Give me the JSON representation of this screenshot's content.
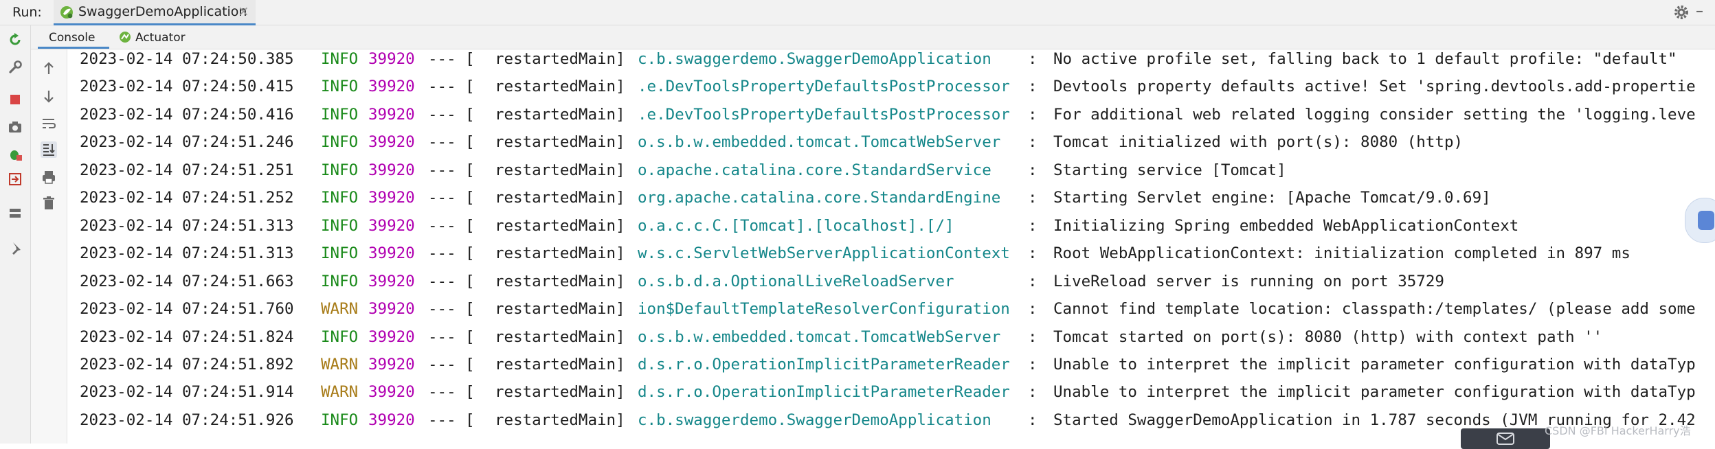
{
  "run_bar": {
    "label": "Run:",
    "tab_title": "SwaggerDemoApplication",
    "close_glyph": "×",
    "minimize_glyph": "–"
  },
  "sub_tabs": [
    {
      "label": "Console",
      "active": true
    },
    {
      "label": "Actuator",
      "active": false
    }
  ],
  "left_toolbar_icons": [
    "rerun-icon",
    "wrench-icon",
    "stop-icon",
    "camera-icon",
    "debug-icon",
    "exit-icon",
    "layout-icon",
    "pin-icon"
  ],
  "console_toolbar_icons": [
    "scroll-up-icon",
    "scroll-down-icon",
    "soft-wrap-icon",
    "scroll-to-end-icon",
    "print-icon",
    "clear-icon"
  ],
  "colors": {
    "info": "#1a8a1a",
    "warn": "#a77b17",
    "pid": "#b100b1",
    "logger": "#15878a",
    "accent": "#4a88c7"
  },
  "log_lines": [
    {
      "ts": "2023-02-14 07:24:50.385",
      "level": "INFO",
      "pid": "39920",
      "dash": "--- [",
      "thread": "restartedMain]",
      "logger": "c.b.swaggerdemo.SwaggerDemoApplication",
      "colon": ":",
      "msg": "No active profile set, falling back to 1 default profile: \"default\""
    },
    {
      "ts": "2023-02-14 07:24:50.415",
      "level": "INFO",
      "pid": "39920",
      "dash": "--- [",
      "thread": "restartedMain]",
      "logger": ".e.DevToolsPropertyDefaultsPostProcessor",
      "colon": ":",
      "msg": "Devtools property defaults active! Set 'spring.devtools.add-propertie"
    },
    {
      "ts": "2023-02-14 07:24:50.416",
      "level": "INFO",
      "pid": "39920",
      "dash": "--- [",
      "thread": "restartedMain]",
      "logger": ".e.DevToolsPropertyDefaultsPostProcessor",
      "colon": ":",
      "msg": "For additional web related logging consider setting the 'logging.leve"
    },
    {
      "ts": "2023-02-14 07:24:51.246",
      "level": "INFO",
      "pid": "39920",
      "dash": "--- [",
      "thread": "restartedMain]",
      "logger": "o.s.b.w.embedded.tomcat.TomcatWebServer",
      "colon": ":",
      "msg": "Tomcat initialized with port(s): 8080 (http)"
    },
    {
      "ts": "2023-02-14 07:24:51.251",
      "level": "INFO",
      "pid": "39920",
      "dash": "--- [",
      "thread": "restartedMain]",
      "logger": "o.apache.catalina.core.StandardService",
      "colon": ":",
      "msg": "Starting service [Tomcat]"
    },
    {
      "ts": "2023-02-14 07:24:51.252",
      "level": "INFO",
      "pid": "39920",
      "dash": "--- [",
      "thread": "restartedMain]",
      "logger": "org.apache.catalina.core.StandardEngine",
      "colon": ":",
      "msg": "Starting Servlet engine: [Apache Tomcat/9.0.69]"
    },
    {
      "ts": "2023-02-14 07:24:51.313",
      "level": "INFO",
      "pid": "39920",
      "dash": "--- [",
      "thread": "restartedMain]",
      "logger": "o.a.c.c.C.[Tomcat].[localhost].[/]",
      "colon": ":",
      "msg": "Initializing Spring embedded WebApplicationContext"
    },
    {
      "ts": "2023-02-14 07:24:51.313",
      "level": "INFO",
      "pid": "39920",
      "dash": "--- [",
      "thread": "restartedMain]",
      "logger": "w.s.c.ServletWebServerApplicationContext",
      "colon": ":",
      "msg": "Root WebApplicationContext: initialization completed in 897 ms"
    },
    {
      "ts": "2023-02-14 07:24:51.663",
      "level": "INFO",
      "pid": "39920",
      "dash": "--- [",
      "thread": "restartedMain]",
      "logger": "o.s.b.d.a.OptionalLiveReloadServer",
      "colon": ":",
      "msg": "LiveReload server is running on port 35729"
    },
    {
      "ts": "2023-02-14 07:24:51.760",
      "level": "WARN",
      "pid": "39920",
      "dash": "--- [",
      "thread": "restartedMain]",
      "logger": "ion$DefaultTemplateResolverConfiguration",
      "colon": ":",
      "msg": "Cannot find template location: classpath:/templates/ (please add some"
    },
    {
      "ts": "2023-02-14 07:24:51.824",
      "level": "INFO",
      "pid": "39920",
      "dash": "--- [",
      "thread": "restartedMain]",
      "logger": "o.s.b.w.embedded.tomcat.TomcatWebServer",
      "colon": ":",
      "msg": "Tomcat started on port(s): 8080 (http) with context path ''"
    },
    {
      "ts": "2023-02-14 07:24:51.892",
      "level": "WARN",
      "pid": "39920",
      "dash": "--- [",
      "thread": "restartedMain]",
      "logger": "d.s.r.o.OperationImplicitParameterReader",
      "colon": ":",
      "msg": "Unable to interpret the implicit parameter configuration with dataTyp"
    },
    {
      "ts": "2023-02-14 07:24:51.914",
      "level": "WARN",
      "pid": "39920",
      "dash": "--- [",
      "thread": "restartedMain]",
      "logger": "d.s.r.o.OperationImplicitParameterReader",
      "colon": ":",
      "msg": "Unable to interpret the implicit parameter configuration with dataTyp"
    },
    {
      "ts": "2023-02-14 07:24:51.926",
      "level": "INFO",
      "pid": "39920",
      "dash": "--- [",
      "thread": "restartedMain]",
      "logger": "c.b.swaggerdemo.SwaggerDemoApplication",
      "colon": ":",
      "msg": "Started SwaggerDemoApplication in 1.787 seconds (JVM running for 2.42"
    }
  ],
  "watermark": "CSDN @FBI HackerHarry浩"
}
